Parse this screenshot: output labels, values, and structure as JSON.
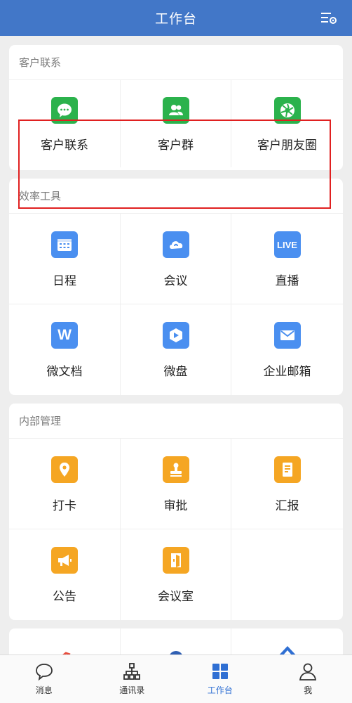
{
  "header": {
    "title": "工作台"
  },
  "sections": [
    {
      "title": "客户联系",
      "items": [
        {
          "label": "客户联系",
          "icon": "chat-bubble-icon",
          "color": "#2bb24c"
        },
        {
          "label": "客户群",
          "icon": "group-icon",
          "color": "#2bb24c"
        },
        {
          "label": "客户朋友圈",
          "icon": "moments-icon",
          "color": "#2bb24c"
        }
      ]
    },
    {
      "title": "效率工具",
      "items": [
        {
          "label": "日程",
          "icon": "calendar-icon",
          "color": "#4a8ff0"
        },
        {
          "label": "会议",
          "icon": "meeting-cloud-icon",
          "color": "#4a8ff0"
        },
        {
          "label": "直播",
          "icon": "live-icon",
          "color": "#4a8ff0",
          "badge": "LIVE"
        },
        {
          "label": "微文档",
          "icon": "doc-w-icon",
          "color": "#4a8ff0",
          "badge": "W"
        },
        {
          "label": "微盘",
          "icon": "drive-icon",
          "color": "#4a8ff0"
        },
        {
          "label": "企业邮箱",
          "icon": "mail-icon",
          "color": "#4a8ff0"
        }
      ]
    },
    {
      "title": "内部管理",
      "items": [
        {
          "label": "打卡",
          "icon": "location-icon",
          "color": "#f5a623"
        },
        {
          "label": "审批",
          "icon": "stamp-icon",
          "color": "#f5a623"
        },
        {
          "label": "汇报",
          "icon": "report-icon",
          "color": "#f5a623"
        },
        {
          "label": "公告",
          "icon": "megaphone-icon",
          "color": "#f5a623"
        },
        {
          "label": "会议室",
          "icon": "door-icon",
          "color": "#f5a623"
        }
      ]
    }
  ],
  "tabbar": [
    {
      "label": "消息",
      "icon": "message-icon"
    },
    {
      "label": "通讯录",
      "icon": "org-chart-icon"
    },
    {
      "label": "工作台",
      "icon": "workbench-grid-icon",
      "active": true
    },
    {
      "label": "我",
      "icon": "profile-icon"
    }
  ],
  "colors": {
    "header": "#4277c8",
    "active_tab": "#2f6fd3",
    "highlight": "#e02020"
  }
}
